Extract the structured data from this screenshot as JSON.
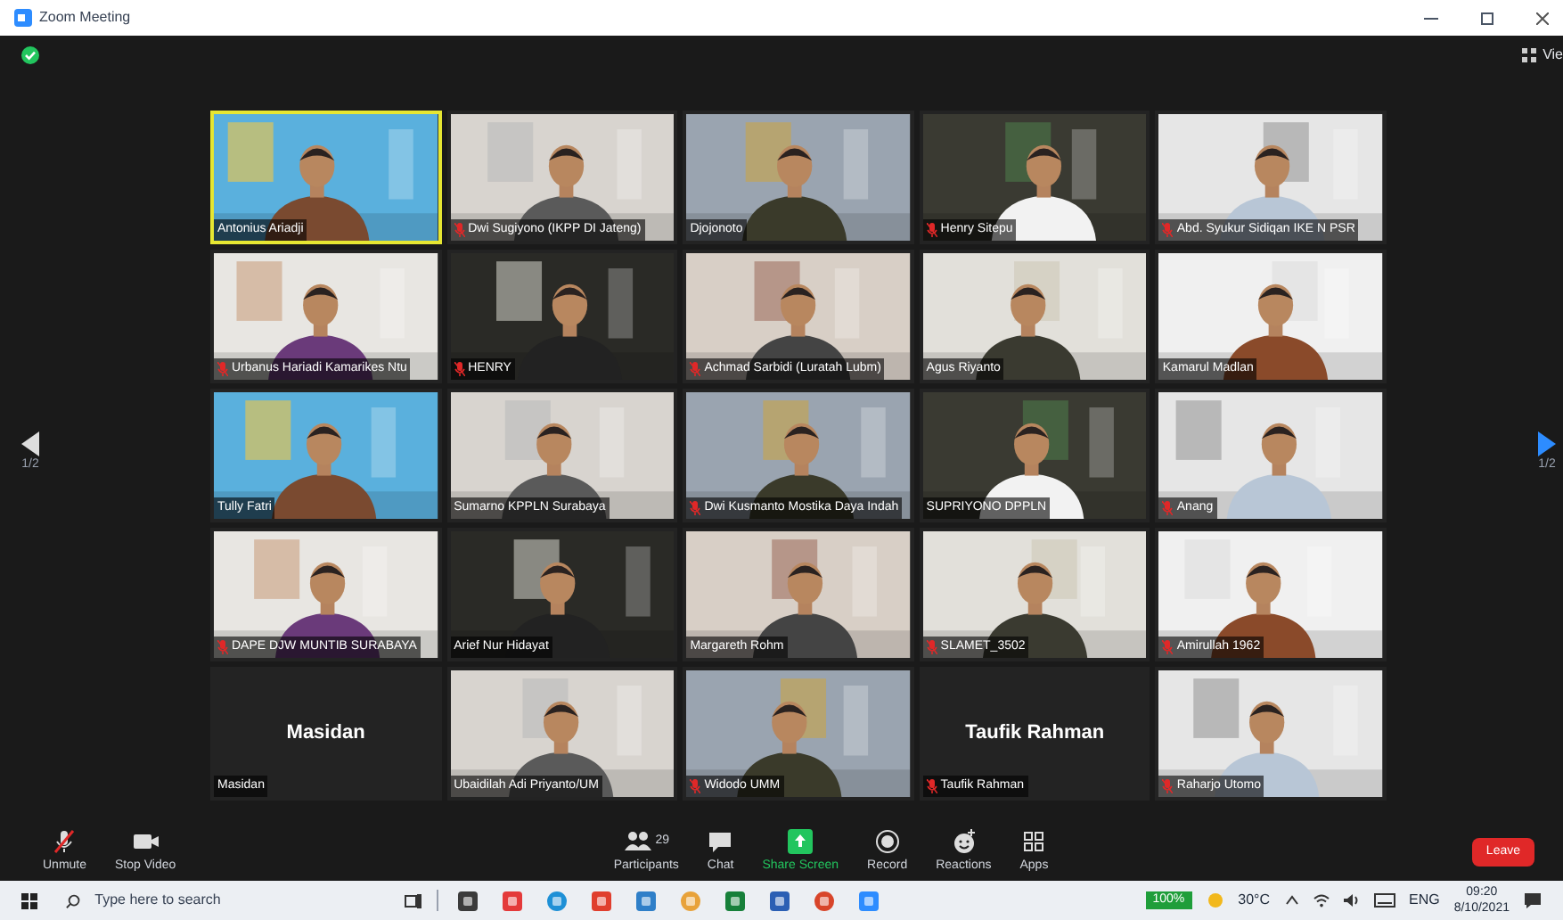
{
  "window": {
    "title": "Zoom Meeting"
  },
  "view_button": {
    "label": "Vie"
  },
  "pager": {
    "left": "1/2",
    "right": "1/2"
  },
  "tiles": [
    {
      "kind": "video",
      "name": "Antonius Ariadji",
      "muted": false,
      "speaking": true
    },
    {
      "kind": "video",
      "name": "Dwi Sugiyono (IKPP DI Jateng)",
      "muted": true,
      "speaking": false
    },
    {
      "kind": "video",
      "name": "Djojonoto",
      "muted": false,
      "speaking": false
    },
    {
      "kind": "video",
      "name": "Henry Sitepu",
      "muted": true,
      "speaking": false
    },
    {
      "kind": "video",
      "name": "Abd. Syukur Sidiqan IKE N PSR",
      "muted": true,
      "speaking": false
    },
    {
      "kind": "video",
      "name": "Urbanus Hariadi Kamarikes Ntu",
      "muted": true,
      "speaking": false
    },
    {
      "kind": "video",
      "name": "HENRY",
      "muted": true,
      "speaking": false
    },
    {
      "kind": "video",
      "name": "Achmad Sarbidi (Luratah Lubm)",
      "muted": true,
      "speaking": false
    },
    {
      "kind": "video",
      "name": "Agus Riyanto",
      "muted": false,
      "speaking": false
    },
    {
      "kind": "video",
      "name": "Kamarul Madlan",
      "muted": false,
      "speaking": false
    },
    {
      "kind": "video",
      "name": "Tully Fatri",
      "muted": false,
      "speaking": false
    },
    {
      "kind": "video",
      "name": "Sumarno KPPLN Surabaya",
      "muted": false,
      "speaking": false
    },
    {
      "kind": "video",
      "name": "Dwi Kusmanto Mostika Daya Indah",
      "muted": true,
      "speaking": false
    },
    {
      "kind": "video",
      "name": "SUPRIYONO DPPLN",
      "muted": false,
      "speaking": false
    },
    {
      "kind": "video",
      "name": "Anang",
      "muted": true,
      "speaking": false
    },
    {
      "kind": "video",
      "name": "DAPE DJW MUNTIB SURABAYA",
      "muted": true,
      "speaking": false
    },
    {
      "kind": "video",
      "name": "Arief Nur Hidayat",
      "muted": false,
      "speaking": false
    },
    {
      "kind": "video",
      "name": "Margareth Rohm",
      "muted": false,
      "speaking": false
    },
    {
      "kind": "video",
      "name": "SLAMET_3502",
      "muted": true,
      "speaking": false
    },
    {
      "kind": "video",
      "name": "Amirullah 1962",
      "muted": true,
      "speaking": false
    },
    {
      "kind": "name",
      "display": "Masidan",
      "name": "Masidan",
      "muted": false,
      "speaking": false
    },
    {
      "kind": "video",
      "name": "Ubaidilah Adi Priyanto/UM",
      "muted": false,
      "speaking": false
    },
    {
      "kind": "video",
      "name": "Widodo UMM",
      "muted": true,
      "speaking": false
    },
    {
      "kind": "name",
      "display": "Taufik Rahman",
      "name": "Taufik Rahman",
      "muted": true,
      "speaking": false
    },
    {
      "kind": "video",
      "name": "Raharjo Utomo",
      "muted": true,
      "speaking": false
    }
  ],
  "toolbar": [
    {
      "kind": "mic",
      "label": "Unmute"
    },
    {
      "kind": "video",
      "label": "Stop Video"
    },
    {
      "kind": "participants",
      "label": "Participants",
      "count": "29"
    },
    {
      "kind": "chat",
      "label": "Chat"
    },
    {
      "kind": "share",
      "label": "Share Screen"
    },
    {
      "kind": "record",
      "label": "Record"
    },
    {
      "kind": "reactions",
      "label": "Reactions"
    },
    {
      "kind": "apps",
      "label": "Apps"
    }
  ],
  "leave_button": "Leave",
  "taskbar": {
    "search_placeholder": "Type here to search",
    "battery": "100%",
    "weather": "30°C",
    "language": "ENG",
    "time": "09:20",
    "date": "8/10/2021"
  }
}
